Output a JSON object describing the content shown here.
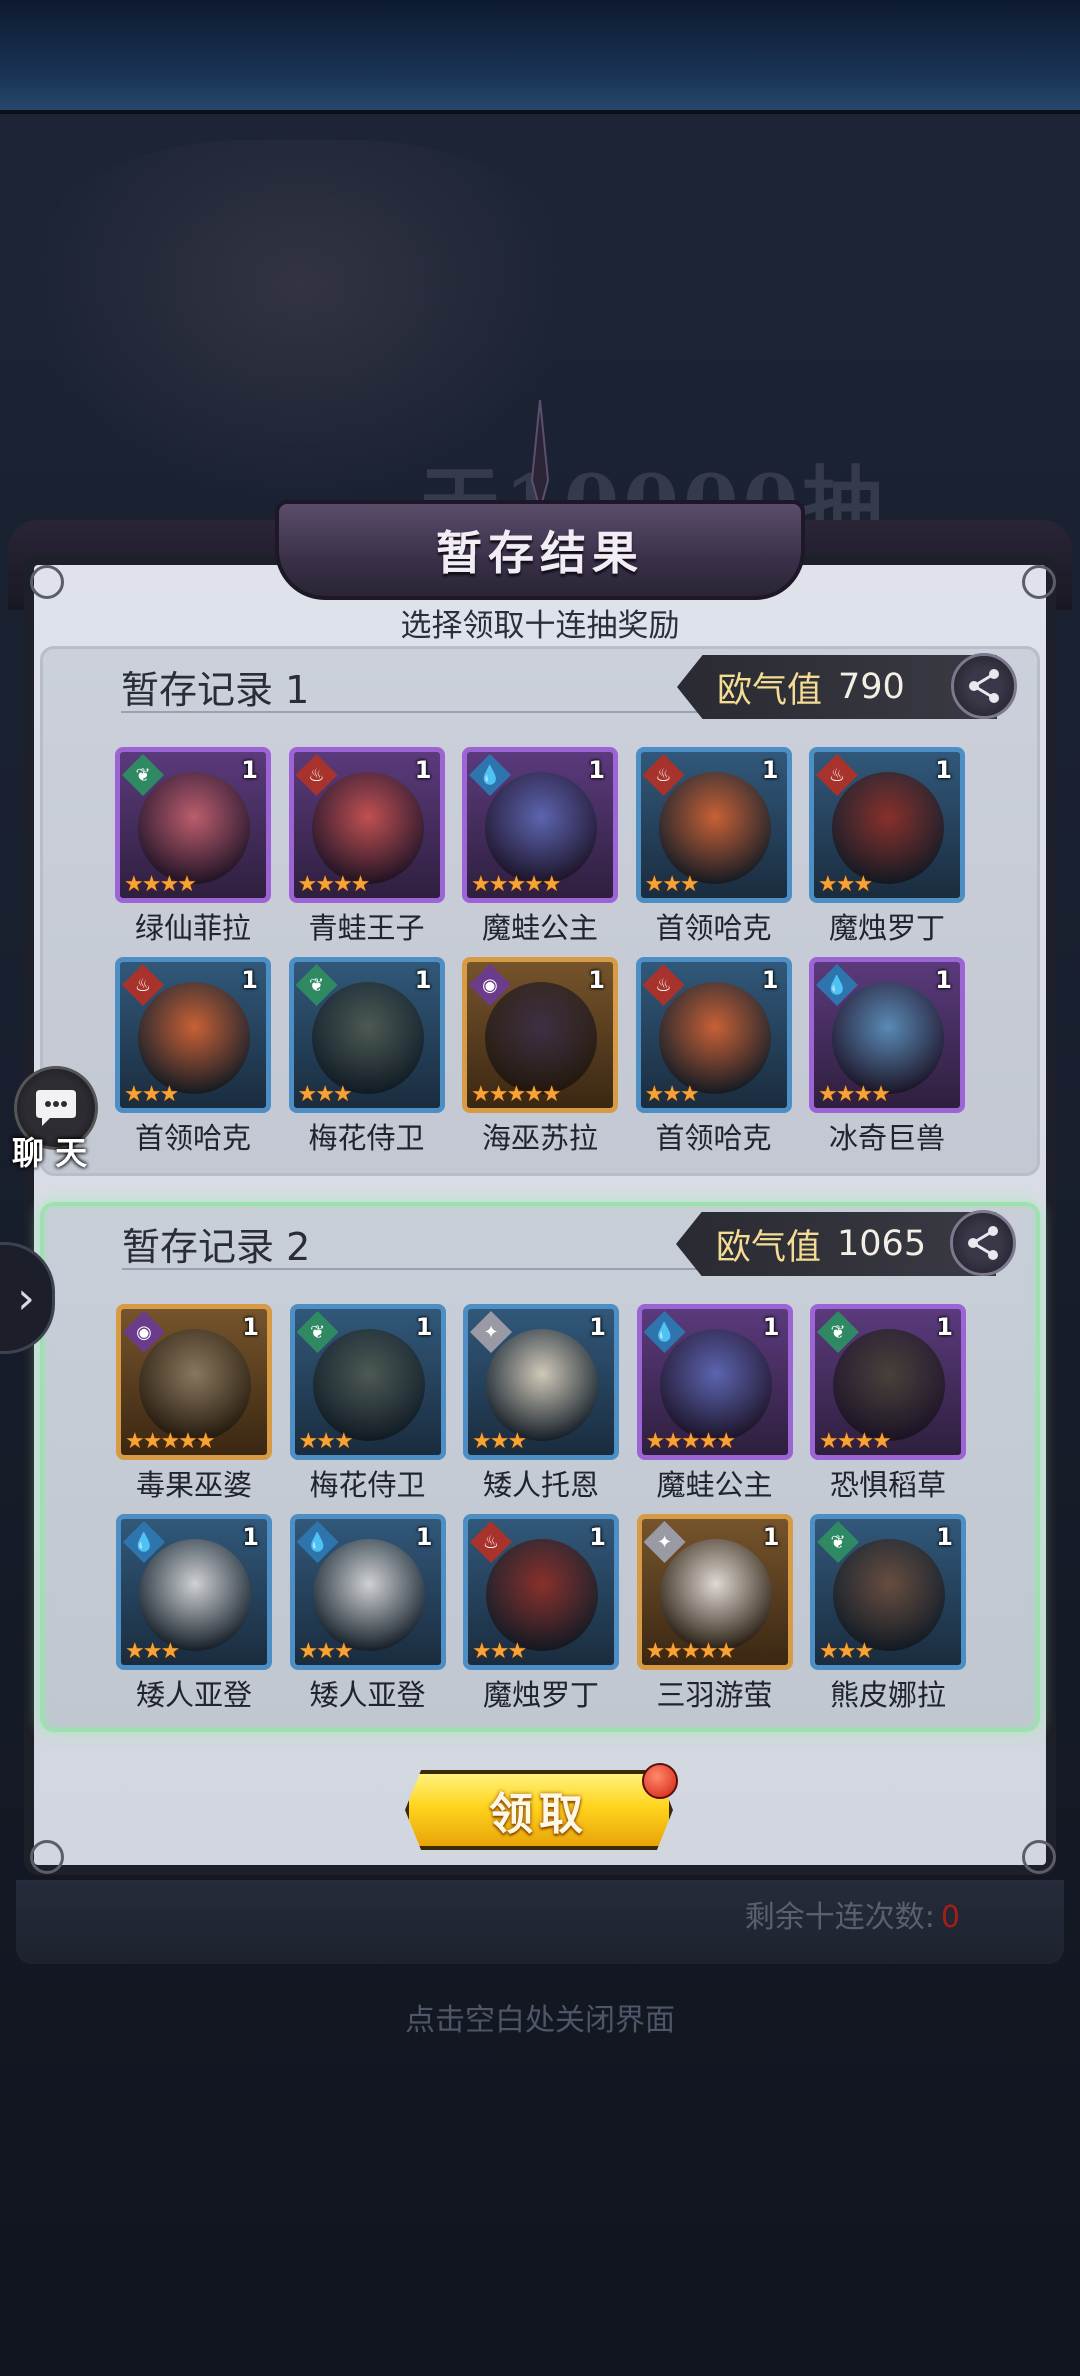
{
  "header": {
    "title": "暂存结果",
    "subtitle": "选择领取十连抽奖励"
  },
  "background": {
    "banner_text": "天10000抽"
  },
  "records": [
    {
      "title": "暂存记录 1",
      "luck_label": "欧气值",
      "luck_value": "790",
      "heroes": [
        {
          "name": "绿仙菲拉",
          "count": "1",
          "stars": "★★★★",
          "frame": "purple",
          "element": "leaf",
          "color": "#c2606d"
        },
        {
          "name": "青蛙王子",
          "count": "1",
          "stars": "★★★★",
          "frame": "purple",
          "element": "fire",
          "color": "#c6524f"
        },
        {
          "name": "魔蛙公主",
          "count": "1",
          "stars": "★★★★★",
          "frame": "purple",
          "element": "water",
          "color": "#5c67b3"
        },
        {
          "name": "首领哈克",
          "count": "1",
          "stars": "★★★",
          "frame": "blue",
          "element": "fire",
          "color": "#d06233"
        },
        {
          "name": "魔烛罗丁",
          "count": "1",
          "stars": "★★★",
          "frame": "blue",
          "element": "fire",
          "color": "#8e2f28"
        },
        {
          "name": "首领哈克",
          "count": "1",
          "stars": "★★★",
          "frame": "blue",
          "element": "fire",
          "color": "#d06233"
        },
        {
          "name": "梅花侍卫",
          "count": "1",
          "stars": "★★★",
          "frame": "blue",
          "element": "leaf",
          "color": "#4e5a52"
        },
        {
          "name": "海巫苏拉",
          "count": "1",
          "stars": "★★★★★",
          "frame": "gold",
          "element": "dark",
          "color": "#3c2f45"
        },
        {
          "name": "首领哈克",
          "count": "1",
          "stars": "★★★",
          "frame": "blue",
          "element": "fire",
          "color": "#d06233"
        },
        {
          "name": "冰奇巨兽",
          "count": "1",
          "stars": "★★★★",
          "frame": "purple",
          "element": "water",
          "color": "#5a8fb8"
        }
      ]
    },
    {
      "title": "暂存记录 2",
      "luck_label": "欧气值",
      "luck_value": "1065",
      "heroes": [
        {
          "name": "毒果巫婆",
          "count": "1",
          "stars": "★★★★★",
          "frame": "gold",
          "element": "dark",
          "color": "#8a7a62"
        },
        {
          "name": "梅花侍卫",
          "count": "1",
          "stars": "★★★",
          "frame": "blue",
          "element": "leaf",
          "color": "#4e5a52"
        },
        {
          "name": "矮人托恩",
          "count": "1",
          "stars": "★★★",
          "frame": "blue",
          "element": "light",
          "color": "#d9cfbd"
        },
        {
          "name": "魔蛙公主",
          "count": "1",
          "stars": "★★★★★",
          "frame": "purple",
          "element": "water",
          "color": "#5c67b3"
        },
        {
          "name": "恐惧稻草",
          "count": "1",
          "stars": "★★★★",
          "frame": "purple",
          "element": "leaf",
          "color": "#474238"
        },
        {
          "name": "矮人亚登",
          "count": "1",
          "stars": "★★★",
          "frame": "blue",
          "element": "water",
          "color": "#d8d8d8"
        },
        {
          "name": "矮人亚登",
          "count": "1",
          "stars": "★★★",
          "frame": "blue",
          "element": "water",
          "color": "#d8d8d8"
        },
        {
          "name": "魔烛罗丁",
          "count": "1",
          "stars": "★★★",
          "frame": "blue",
          "element": "fire",
          "color": "#8e2f28"
        },
        {
          "name": "三羽游萤",
          "count": "1",
          "stars": "★★★★★",
          "frame": "gold",
          "element": "light",
          "color": "#e5e0dc"
        },
        {
          "name": "熊皮娜拉",
          "count": "1",
          "stars": "★★★",
          "frame": "blue",
          "element": "leaf",
          "color": "#6b4d3d"
        }
      ]
    }
  ],
  "claim_button": {
    "label": "领取"
  },
  "footer": {
    "remaining_label": "剩余十连次数:",
    "remaining_value": "0",
    "close_hint": "点击空白处关闭界面"
  },
  "chat": {
    "label": "聊 天"
  },
  "side_arrow": {
    "label": "›"
  },
  "colors": {
    "frame_purple": "#9d64d6",
    "frame_blue": "#4d8ec5",
    "frame_gold": "#d79a45",
    "elem_fire": "#a8322c",
    "elem_leaf": "#2f8a63",
    "elem_water": "#2f75ad",
    "elem_dark": "#6b3b8c",
    "elem_light": "#9a9aa5",
    "accent_green": "#9fe0b0",
    "button_gold": "#ffd41e"
  }
}
